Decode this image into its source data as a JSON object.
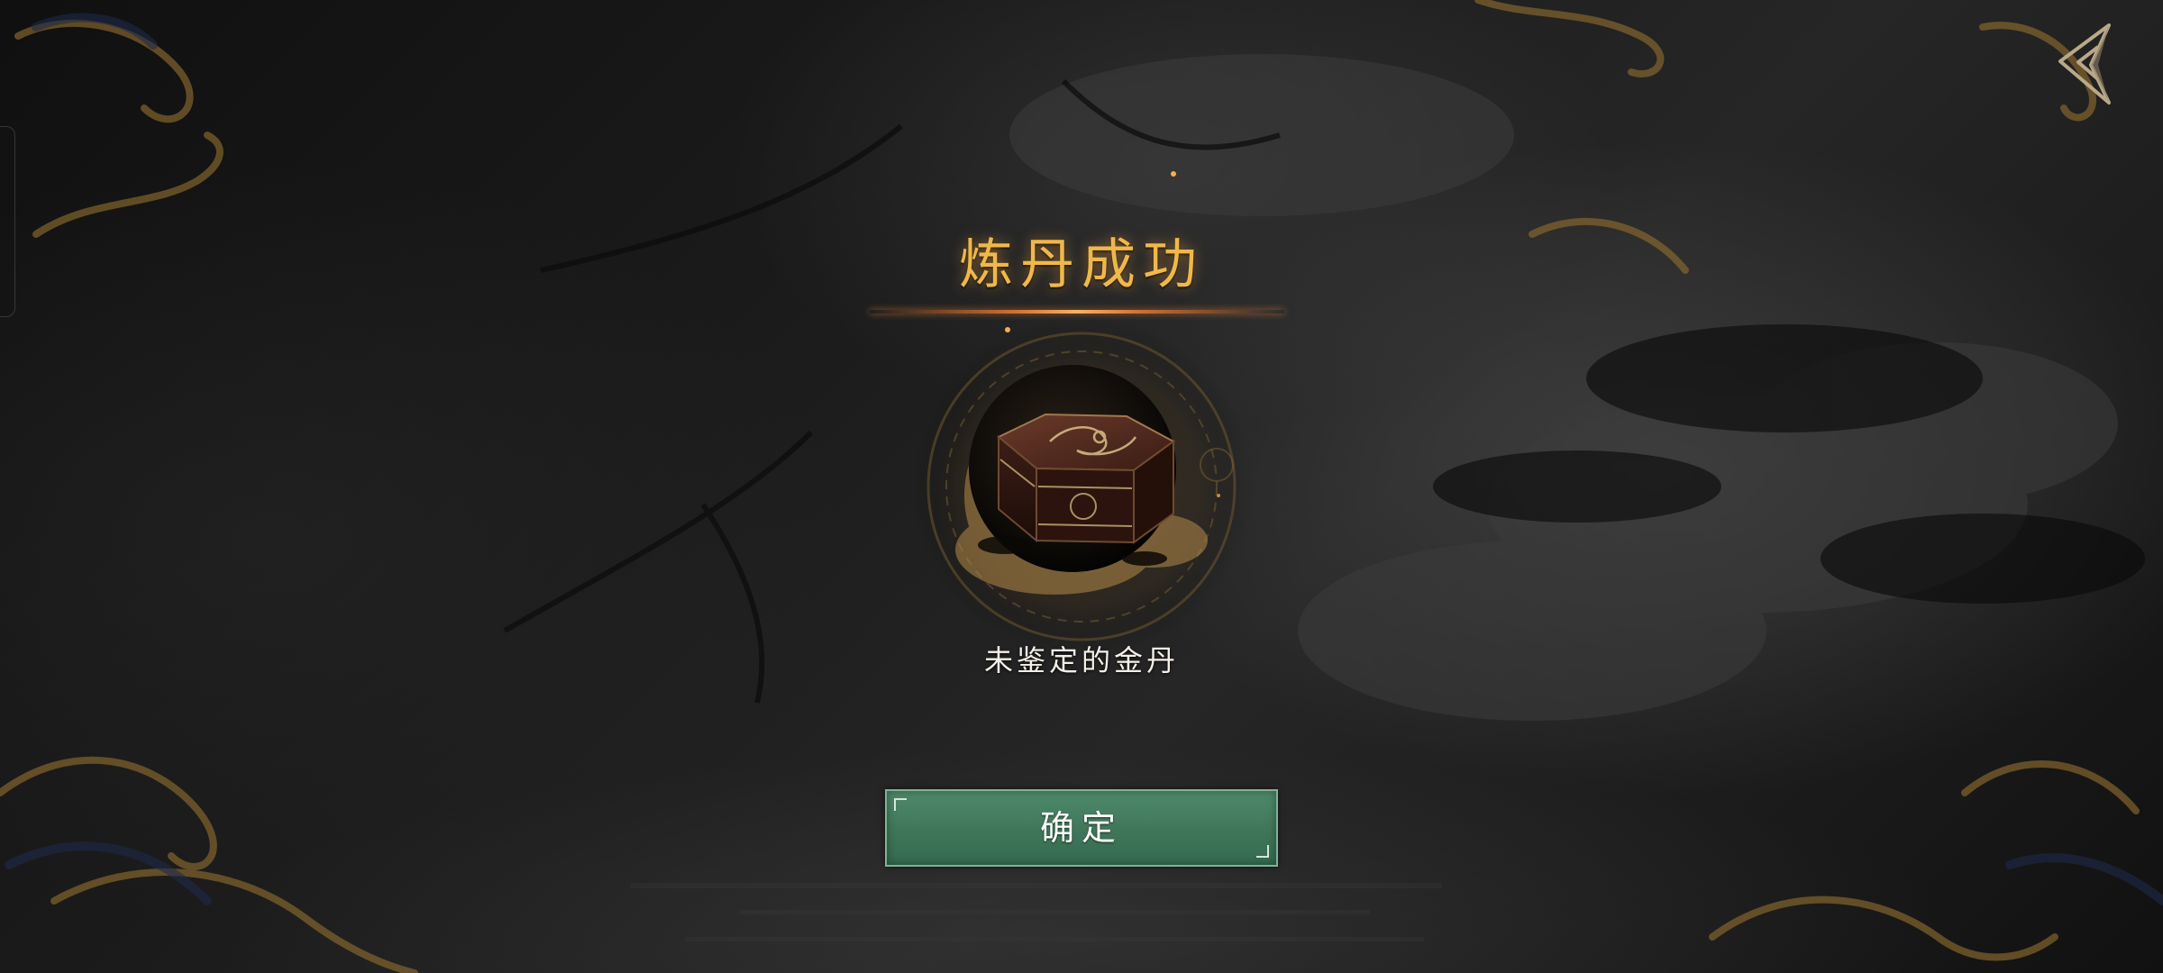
{
  "dialog": {
    "title": "炼丹成功",
    "item_name": "未鉴定的金丹",
    "confirm_label": "确定"
  },
  "icons": {
    "back": "back-arrow-icon",
    "item": "hexagonal-box-icon"
  },
  "colors": {
    "title_gold": "#f0b84a",
    "button_green": "#3f7659",
    "divider_orange": "#e07830"
  }
}
